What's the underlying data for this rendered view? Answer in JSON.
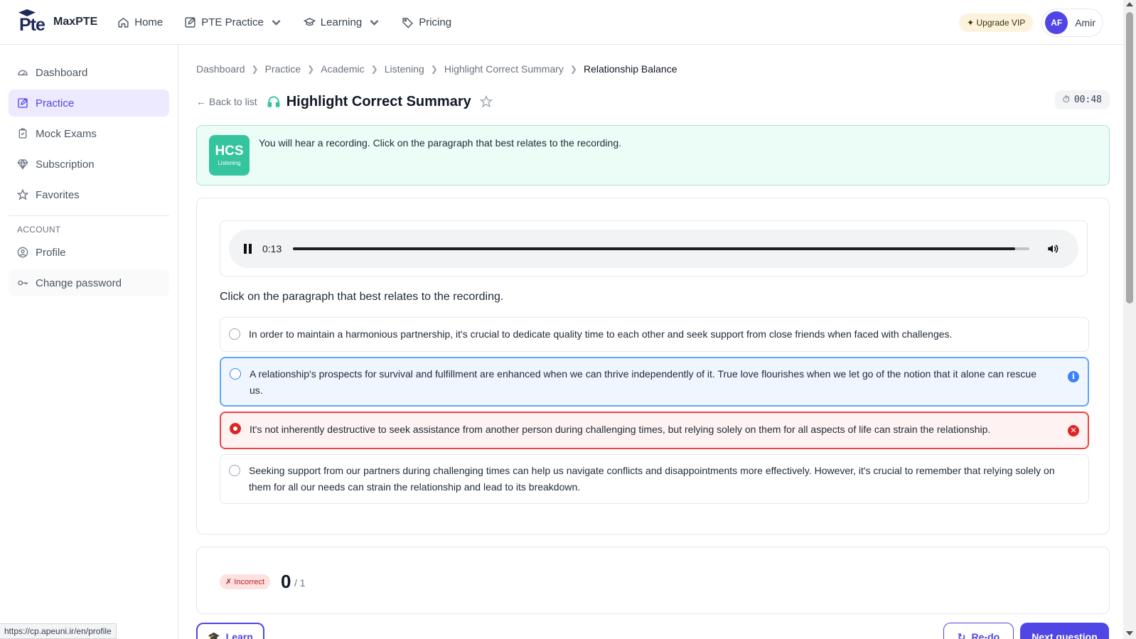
{
  "brand": {
    "logo_text": "Pte",
    "name": "MaxPTE"
  },
  "nav": [
    {
      "label": "Home",
      "icon": "home-icon"
    },
    {
      "label": "PTE Practice",
      "icon": "edit-icon",
      "has_dropdown": true
    },
    {
      "label": "Learning",
      "icon": "graduation-cap-icon",
      "has_dropdown": true
    },
    {
      "label": "Pricing",
      "icon": "tag-icon"
    }
  ],
  "header": {
    "upgrade_label": "✦ Upgrade VIP",
    "user_initials": "AF",
    "user_name": "Amir"
  },
  "sidebar": {
    "items": [
      {
        "label": "Dashboard",
        "icon": "gauge-icon"
      },
      {
        "label": "Practice",
        "icon": "edit-icon",
        "active": true
      },
      {
        "label": "Mock Exams",
        "icon": "clipboard-icon"
      },
      {
        "label": "Subscription",
        "icon": "diamond-icon"
      },
      {
        "label": "Favorites",
        "icon": "star-icon"
      }
    ],
    "account_label": "ACCOUNT",
    "account_items": [
      {
        "label": "Profile",
        "icon": "user-circle-icon"
      },
      {
        "label": "Change password",
        "icon": "key-icon"
      }
    ]
  },
  "breadcrumb": [
    "Dashboard",
    "Practice",
    "Academic",
    "Listening",
    "Highlight Correct Summary",
    "Relationship Balance"
  ],
  "page": {
    "back_label": "Back to list",
    "title": "Highlight Correct Summary",
    "timer": "00:48"
  },
  "instruction": {
    "badge_code": "HCS",
    "badge_sub": "Listening",
    "text": "You will hear a recording. Click on the paragraph that best relates to the recording."
  },
  "player": {
    "time": "0:13",
    "progress": 0.98
  },
  "question": "Click on the paragraph that best relates to the recording.",
  "options": [
    {
      "text": "In order to maintain a harmonious partnership, it's crucial to dedicate quality time to each other and seek support from close friends when faced with challenges.",
      "state": "normal"
    },
    {
      "text": "A relationship's prospects for survival and fulfillment are enhanced when we can thrive independently of it. True love flourishes when we let go of the notion that it alone can rescue us.",
      "state": "correct-answer"
    },
    {
      "text": "It's not inherently destructive to seek assistance from another person during challenging times, but relying solely on them for all aspects of life can strain the relationship.",
      "state": "selected-wrong"
    },
    {
      "text": "Seeking support from our partners during challenging times can help us navigate conflicts and disappointments more effectively. However, it's crucial to remember that relying solely on them for all our needs can strain the relationship and lead to its breakdown.",
      "state": "normal"
    }
  ],
  "result": {
    "badge": "✗ Incorrect",
    "score": "0",
    "max": "/ 1"
  },
  "actions": {
    "learn": "Learn",
    "redo": "Re-do",
    "next": "Next question"
  },
  "status_url": "https://cp.apeuni.ir/en/profile",
  "colors": {
    "accent": "#4f46e5",
    "success": "#34c49e",
    "error": "#dc2626",
    "info": "#3b82f6"
  }
}
